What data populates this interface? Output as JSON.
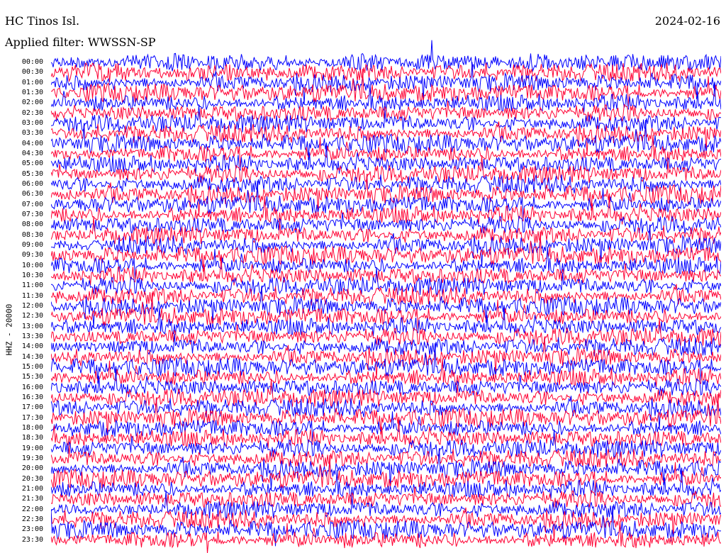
{
  "header": {
    "station": "HC Tinos Isl.",
    "date": "2024-02-16",
    "filter": "Applied filter: WWSSN-SP"
  },
  "chart_data": {
    "type": "line",
    "title": "HC Tinos Isl.",
    "date": "2024-02-16",
    "filter": "Applied filter: WWSSN-SP",
    "ylabel": "HHZ - 20000",
    "row_labels": [
      "00:00",
      "00:30",
      "01:00",
      "01:30",
      "02:00",
      "02:30",
      "03:00",
      "03:30",
      "04:00",
      "04:30",
      "05:00",
      "05:30",
      "06:00",
      "06:30",
      "07:00",
      "07:30",
      "08:00",
      "08:30",
      "09:00",
      "09:30",
      "10:00",
      "10:30",
      "11:00",
      "11:30",
      "12:00",
      "12:30",
      "13:00",
      "13:30",
      "14:00",
      "14:30",
      "15:00",
      "15:30",
      "16:00",
      "16:30",
      "17:00",
      "17:30",
      "18:00",
      "18:30",
      "19:00",
      "19:30",
      "20:00",
      "20:30",
      "21:00",
      "21:30",
      "22:00",
      "22:30",
      "23:00",
      "23:30"
    ],
    "series_colors": [
      "#0000ff",
      "#ff0033"
    ],
    "row_color_order": "alternating"
  }
}
